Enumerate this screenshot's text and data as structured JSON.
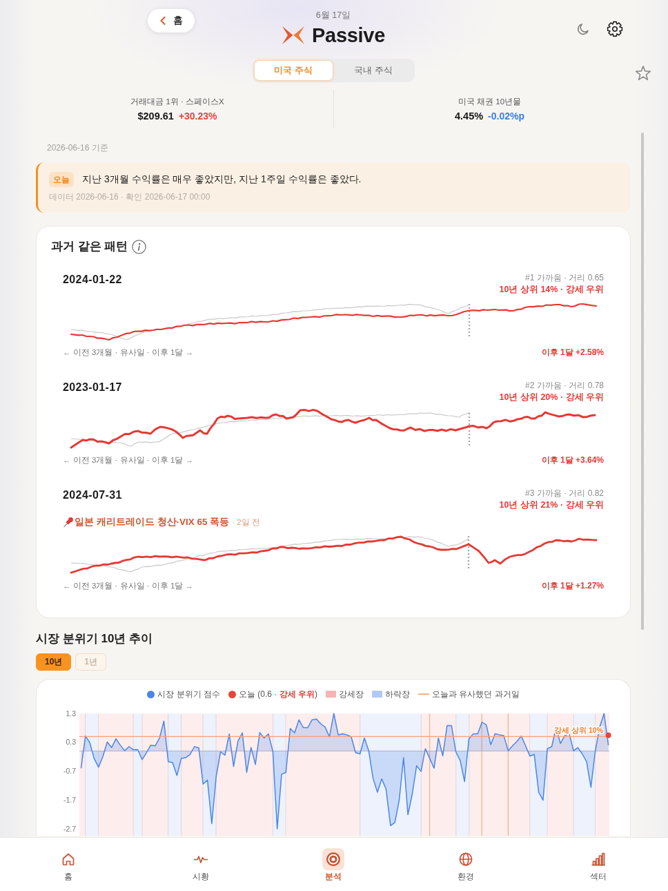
{
  "header": {
    "back_button": "홈",
    "date": "6월 17일",
    "logo_text": "Passive"
  },
  "tabs": [
    {
      "label": "미국 주식",
      "selected": true
    },
    {
      "label": "국내 주식",
      "selected": false
    }
  ],
  "stats": [
    {
      "label": "거래대금 1위 · 스페이스X",
      "value": "$209.61",
      "change": "+30.23%",
      "color": "#e8423f"
    },
    {
      "label": "미국 채권 10년물",
      "value": "4.45%",
      "change": "-0.02%p",
      "color": "#3b7fe6"
    }
  ],
  "as_of": "2026-06-16 기준",
  "notice": {
    "badge": "오늘",
    "text": "지난 3개월 수익률은 매우 좋았지만, 지난 1주일 수익률은 좋았다.",
    "meta": "데이터 2026-06-16 · 확인 2026-06-17 00:00"
  },
  "patterns": {
    "title": "과거 같은 패턴",
    "items": [
      {
        "date": "2024-01-22",
        "rank": "#1 가까움 · 거리 0.65",
        "rating": "10년 상위 14% · 강세 우위",
        "range_note": "← 이전 3개월 · 유사일 · 이후 1달 →",
        "outcome": "이후 1달 +2.58%"
      },
      {
        "date": "2023-01-17",
        "rank": "#2 가까움 · 거리 0.78",
        "rating": "10년 상위 20% · 강세 우위",
        "range_note": "← 이전 3개월 · 유사일 · 이후 1달 →",
        "outcome": "이후 1달 +3.64%"
      },
      {
        "date": "2024-07-31",
        "rank": "#3 가까움 · 거리 0.82",
        "rating": "10년 상위 21% · 강세 우위",
        "event": {
          "title": "일본 캐리트레이드 청산·VIX 65 폭등",
          "age": "· 2일 전"
        },
        "range_note": "← 이전 3개월 · 유사일 · 이후 1달 →",
        "outcome": "이후 1달 +1.27%"
      }
    ]
  },
  "trend": {
    "title": "시장 분위기 10년 추이",
    "ranges": [
      {
        "label": "10년",
        "selected": true
      },
      {
        "label": "1년",
        "selected": false
      }
    ],
    "legend": [
      {
        "kind": "point",
        "label": "오늘 (0.6 · **강세 우위**)",
        "color": "#e8453c"
      },
      {
        "kind": "bull_band",
        "label": "강세장",
        "color": "#f8b4b4"
      },
      {
        "kind": "bear_band",
        "label": "하락장",
        "color": "#b3c8f6"
      },
      {
        "kind": "similar_line",
        "label": "오늘과 유사했던 과거일",
        "color": "#f3b08e"
      }
    ],
    "chart_data": {
      "type": "area",
      "ylim": [
        -2.7,
        1.3
      ],
      "yticks": [
        1.3,
        0.3,
        -0.7,
        -1.7,
        -2.7
      ],
      "grid": true,
      "series": [
        {
          "name": "시장 분위기 점수",
          "color": "#4a86e8",
          "values": [
            -0.6,
            0.52,
            0.29,
            -0.26,
            -0.56,
            -0.19,
            0.31,
            0.12,
            0.42,
            0.2,
            0.01,
            0.15,
            0.04,
            0.05,
            -0.3,
            -0.06,
            0.2,
            0.18,
            0.45,
            1.04,
            -0.37,
            -0.4,
            -0.85,
            -0.26,
            -0.23,
            -0.12,
            0.15,
            0.11,
            -1.15,
            -1.01,
            -2.52,
            -0.88,
            -0.03,
            -0.15,
            0.59,
            -0.54,
            0.34,
            0.63,
            -0.74,
            0.12,
            -0.47,
            0.64,
            0.45,
            0.59,
            -0.02,
            -2.7,
            -0.81,
            -0.74,
            0.78,
            0.63,
            1.08,
            0.81,
            0.81,
            1.08,
            1.11,
            0.94,
            0.83,
            0.49,
            1.3,
            0.56,
            0.59,
            0.56,
            0.49,
            -0.06,
            -0.1,
            0.45,
            0.01,
            -0.95,
            -1.43,
            -0.97,
            -1.33,
            -2.59,
            -2.48,
            -1.7,
            -0.23,
            -2.21,
            -1.49,
            -0.51,
            -0.71,
            0.08,
            -0.26,
            -0.6,
            0.45,
            -0.17,
            0.88,
            0.88,
            -0.03,
            -0.33,
            -1.06,
            0.42,
            0.59,
            0.59,
            1.0,
            0.9,
            0.22,
            0.6,
            0.56,
            0.53,
            0.01,
            0.18,
            0.33,
            0.52,
            0.18,
            -0.18,
            -0.12,
            -1.43,
            -1.71,
            0.08,
            0.15,
            0.81,
            0.26,
            0.53,
            0.6,
            0.01,
            0.12,
            -0.1,
            -0.37,
            -1.26,
            0.01,
            0.83,
            1.3,
            0.2
          ]
        }
      ],
      "ref_lines": [
        {
          "axis": "y",
          "value": 0.5,
          "label": "강세 상위 10%",
          "color": "#f2a27c"
        }
      ]
    }
  },
  "bottom_nav": [
    {
      "label": "홈",
      "selected": false
    },
    {
      "label": "시황",
      "selected": false
    },
    {
      "label": "분석",
      "selected": true
    },
    {
      "label": "환경",
      "selected": false
    },
    {
      "label": "섹터",
      "selected": false
    }
  ]
}
